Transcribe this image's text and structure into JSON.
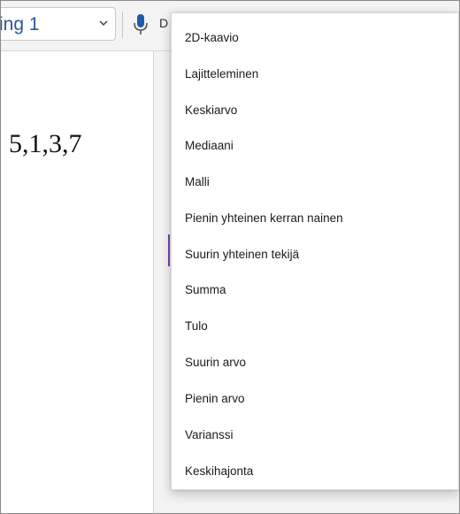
{
  "toolbar": {
    "style_value": "ing 1",
    "dictate_label": "D"
  },
  "document": {
    "text": "5,1,3,7"
  },
  "menu": {
    "items": [
      {
        "label": "2D-kaavio"
      },
      {
        "label": "Lajitteleminen"
      },
      {
        "label": "Keskiarvo"
      },
      {
        "label": "Mediaani"
      },
      {
        "label": "Malli"
      },
      {
        "label": "Pienin yhteinen kerran nainen"
      },
      {
        "label": "Suurin yhteinen tekijä"
      },
      {
        "label": "Summa"
      },
      {
        "label": "Tulo"
      },
      {
        "label": "Suurin arvo"
      },
      {
        "label": "Pienin arvo"
      },
      {
        "label": "Varianssi"
      },
      {
        "label": "Keskihajonta"
      }
    ]
  },
  "colors": {
    "style_text": "#2b579a",
    "mic_icon": "#1f5aa8",
    "cursor_mark": "#7b3fb5"
  }
}
